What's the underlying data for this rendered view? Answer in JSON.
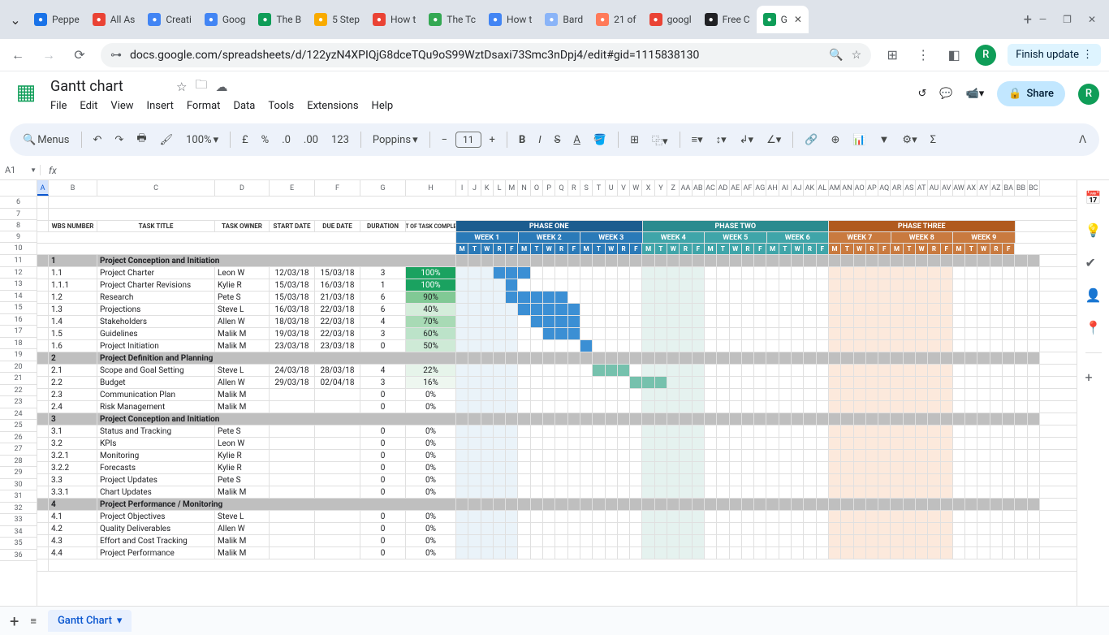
{
  "browser": {
    "tabs": [
      {
        "label": "Peppe",
        "favicon": "#1a73e8"
      },
      {
        "label": "All As",
        "favicon": "#ea4335"
      },
      {
        "label": "Creati",
        "favicon": "#4285f4"
      },
      {
        "label": "Goog",
        "favicon": "#4285f4"
      },
      {
        "label": "The B",
        "favicon": "#0f9d58"
      },
      {
        "label": "5 Step",
        "favicon": "#f9ab00"
      },
      {
        "label": "How t",
        "favicon": "#ea4335"
      },
      {
        "label": "The Tc",
        "favicon": "#34a853"
      },
      {
        "label": "How t",
        "favicon": "#4285f4"
      },
      {
        "label": "Bard",
        "favicon": "#8ab4f8"
      },
      {
        "label": "21 of",
        "favicon": "#ff7a59"
      },
      {
        "label": "googl",
        "favicon": "#ea4335"
      },
      {
        "label": "Free C",
        "favicon": "#202124"
      },
      {
        "label": "G",
        "favicon": "#0f9d58"
      }
    ],
    "url": "docs.google.com/spreadsheets/d/122yzN4XPIQjG8dceTQu9oS99WztDsaxi73Smc3nDpj4/edit#gid=1115838130",
    "finish": "Finish update",
    "profile": "R"
  },
  "doc": {
    "title": "Gantt chart",
    "menus": [
      "File",
      "Edit",
      "View",
      "Insert",
      "Format",
      "Data",
      "Tools",
      "Extensions",
      "Help"
    ],
    "share": "Share",
    "menus_btn": "Menus",
    "zoom": "100%",
    "font": "Poppins",
    "fontSize": "11",
    "namebox": "A1",
    "sheetTab": "Gantt Chart"
  },
  "headers": {
    "wbs": "WBS NUMBER",
    "title": "TASK TITLE",
    "owner": "TASK OWNER",
    "start": "START DATE",
    "due": "DUE DATE",
    "dur": "DURATION",
    "pct": "PCT OF TASK COMPLETE"
  },
  "phases": [
    {
      "name": "PHASE ONE",
      "color": "#1c5d8f",
      "weeks": [
        "WEEK 1",
        "WEEK 2",
        "WEEK 3"
      ],
      "wkcolor": "#2a7ab8"
    },
    {
      "name": "PHASE TWO",
      "color": "#2b8b8f",
      "weeks": [
        "WEEK 4",
        "WEEK 5",
        "WEEK 6"
      ],
      "wkcolor": "#3fa5a9"
    },
    {
      "name": "PHASE THREE",
      "color": "#b05a1e",
      "weeks": [
        "WEEK 7",
        "WEEK 8",
        "WEEK 9"
      ],
      "wkcolor": "#c97a3f"
    }
  ],
  "days": [
    "M",
    "T",
    "W",
    "R",
    "F"
  ],
  "rows": [
    {
      "type": "section",
      "wbs": "1",
      "title": "Project Conception and Initiation"
    },
    {
      "wbs": "1.1",
      "title": "Project Charter",
      "owner": "Leon W",
      "start": "12/03/18",
      "due": "15/03/18",
      "dur": "3",
      "pct": "100%",
      "pcls": "pct100",
      "bar": [
        3,
        3
      ]
    },
    {
      "wbs": "1.1.1",
      "title": "Project Charter Revisions",
      "owner": "Kylie R",
      "start": "15/03/18",
      "due": "16/03/18",
      "dur": "1",
      "pct": "100%",
      "pcls": "pct100",
      "bar": [
        4,
        1
      ]
    },
    {
      "wbs": "1.2",
      "title": "Research",
      "owner": "Pete S",
      "start": "15/03/18",
      "due": "21/03/18",
      "dur": "6",
      "pct": "90%",
      "pcls": "pct90",
      "bar": [
        4,
        5
      ]
    },
    {
      "wbs": "1.3",
      "title": "Projections",
      "owner": "Steve L",
      "start": "16/03/18",
      "due": "22/03/18",
      "dur": "6",
      "pct": "40%",
      "pcls": "pct40",
      "bar": [
        5,
        5
      ]
    },
    {
      "wbs": "1.4",
      "title": "Stakeholders",
      "owner": "Allen W",
      "start": "18/03/18",
      "due": "22/03/18",
      "dur": "4",
      "pct": "70%",
      "pcls": "pct70",
      "bar": [
        6,
        4
      ]
    },
    {
      "wbs": "1.5",
      "title": "Guidelines",
      "owner": "Malik M",
      "start": "19/03/18",
      "due": "22/03/18",
      "dur": "3",
      "pct": "60%",
      "pcls": "pct60",
      "bar": [
        7,
        3
      ]
    },
    {
      "wbs": "1.6",
      "title": "Project Initiation",
      "owner": "Malik M",
      "start": "23/03/18",
      "due": "23/03/18",
      "dur": "0",
      "pct": "50%",
      "pcls": "pct50",
      "bar": [
        10,
        1
      ]
    },
    {
      "type": "section",
      "wbs": "2",
      "title": "Project Definition and Planning"
    },
    {
      "wbs": "2.1",
      "title": "Scope and Goal Setting",
      "owner": "Steve L",
      "start": "24/03/18",
      "due": "28/03/18",
      "dur": "4",
      "pct": "22%",
      "pcls": "pct22",
      "bar2": [
        11,
        3
      ]
    },
    {
      "wbs": "2.2",
      "title": "Budget",
      "owner": "Allen W",
      "start": "29/03/18",
      "due": "02/04/18",
      "dur": "3",
      "pct": "16%",
      "pcls": "pct16",
      "bar2": [
        14,
        3
      ]
    },
    {
      "wbs": "2.3",
      "title": "Communication Plan",
      "owner": "Malik M",
      "start": "",
      "due": "",
      "dur": "0",
      "pct": "0%"
    },
    {
      "wbs": "2.4",
      "title": "Risk Management",
      "owner": "Malik M",
      "start": "",
      "due": "",
      "dur": "0",
      "pct": "0%"
    },
    {
      "type": "section",
      "wbs": "3",
      "title": "Project Conception and Initiation"
    },
    {
      "wbs": "3.1",
      "title": "Status and Tracking",
      "owner": "Pete S",
      "start": "",
      "due": "",
      "dur": "0",
      "pct": "0%"
    },
    {
      "wbs": "3.2",
      "title": "KPIs",
      "owner": "Leon W",
      "start": "",
      "due": "",
      "dur": "0",
      "pct": "0%"
    },
    {
      "wbs": "3.2.1",
      "title": "Monitoring",
      "owner": "Kylie R",
      "start": "",
      "due": "",
      "dur": "0",
      "pct": "0%"
    },
    {
      "wbs": "3.2.2",
      "title": "Forecasts",
      "owner": "Kylie R",
      "start": "",
      "due": "",
      "dur": "0",
      "pct": "0%"
    },
    {
      "wbs": "3.3",
      "title": "Project Updates",
      "owner": "Pete S",
      "start": "",
      "due": "",
      "dur": "0",
      "pct": "0%"
    },
    {
      "wbs": "3.3.1",
      "title": "Chart Updates",
      "owner": "Malik M",
      "start": "",
      "due": "",
      "dur": "0",
      "pct": "0%"
    },
    {
      "type": "section",
      "wbs": "4",
      "title": "Project Performance / Monitoring"
    },
    {
      "wbs": "4.1",
      "title": "Project Objectives",
      "owner": "Steve L",
      "start": "",
      "due": "",
      "dur": "0",
      "pct": "0%"
    },
    {
      "wbs": "4.2",
      "title": "Quality Deliverables",
      "owner": "Allen W",
      "start": "",
      "due": "",
      "dur": "0",
      "pct": "0%"
    },
    {
      "wbs": "4.3",
      "title": "Effort and Cost Tracking",
      "owner": "Malik M",
      "start": "",
      "due": "",
      "dur": "0",
      "pct": "0%"
    },
    {
      "wbs": "4.4",
      "title": "Project Performance",
      "owner": "Malik M",
      "start": "",
      "due": "",
      "dur": "0",
      "pct": "0%"
    }
  ],
  "colLetters": [
    "A",
    "B",
    "C",
    "D",
    "E",
    "F",
    "G",
    "H"
  ],
  "smallCols": [
    "I",
    "J",
    "K",
    "L",
    "M",
    "N",
    "O",
    "P",
    "Q",
    "R",
    "S",
    "T",
    "U",
    "V",
    "W",
    "X",
    "Y",
    "Z",
    "AA",
    "AB",
    "AC",
    "AD",
    "AE",
    "AF",
    "AG",
    "AH",
    "AI",
    "AJ",
    "AK",
    "AL",
    "AM",
    "AN",
    "AO",
    "AP",
    "AQ",
    "AR",
    "AS",
    "AT",
    "AU",
    "AV",
    "AW",
    "AX",
    "AY",
    "AZ",
    "BA",
    "BB",
    "BC"
  ],
  "rowNums": [
    6,
    7,
    8,
    9,
    10,
    11,
    12,
    13,
    14,
    15,
    16,
    17,
    18,
    19,
    20,
    21,
    22,
    23,
    24,
    25,
    26,
    27,
    28,
    29,
    30,
    31,
    32,
    33,
    34,
    35,
    36
  ]
}
